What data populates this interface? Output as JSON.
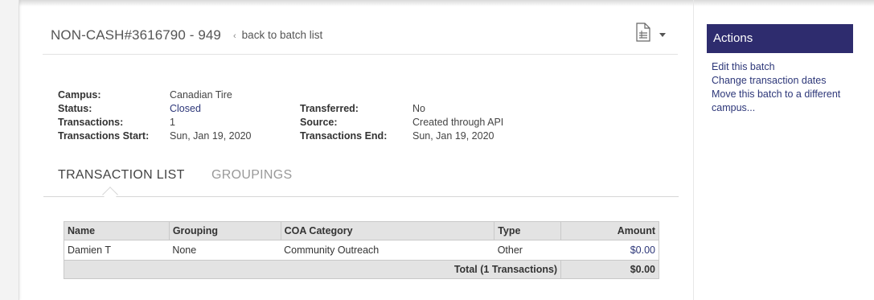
{
  "batch": {
    "title": "NON-CASH#3616790 - 949",
    "back_link": "back to batch list"
  },
  "details": {
    "campus_label": "Campus:",
    "campus_value": "Canadian Tire",
    "status_label": "Status:",
    "status_value": "Closed",
    "transactions_label": "Transactions:",
    "transactions_value": "1",
    "start_label": "Transactions Start:",
    "start_value": "Sun, Jan 19, 2020",
    "transferred_label": "Transferred:",
    "transferred_value": "No",
    "source_label": "Source:",
    "source_value": "Created through API",
    "end_label": "Transactions End:",
    "end_value": "Sun, Jan 19, 2020"
  },
  "tabs": [
    "TRANSACTION LIST",
    "GROUPINGS"
  ],
  "table": {
    "headers": [
      "Name",
      "Grouping",
      "COA Category",
      "Type",
      "Amount"
    ],
    "rows": [
      [
        "Damien T",
        "None",
        "Community Outreach",
        "Other",
        "$0.00"
      ]
    ],
    "total_label": "Total (1 Transactions)",
    "total_amount": "$0.00"
  },
  "actions": {
    "title": "Actions",
    "links": [
      "Edit this batch",
      "Change transaction dates",
      "Move this batch to a different campus..."
    ]
  },
  "colors": {
    "accent": "#2e2c6e",
    "link": "#2d3779"
  },
  "icons": {
    "export": "document-icon",
    "menu": "caret-down-icon",
    "back": "chevron-left-icon"
  }
}
